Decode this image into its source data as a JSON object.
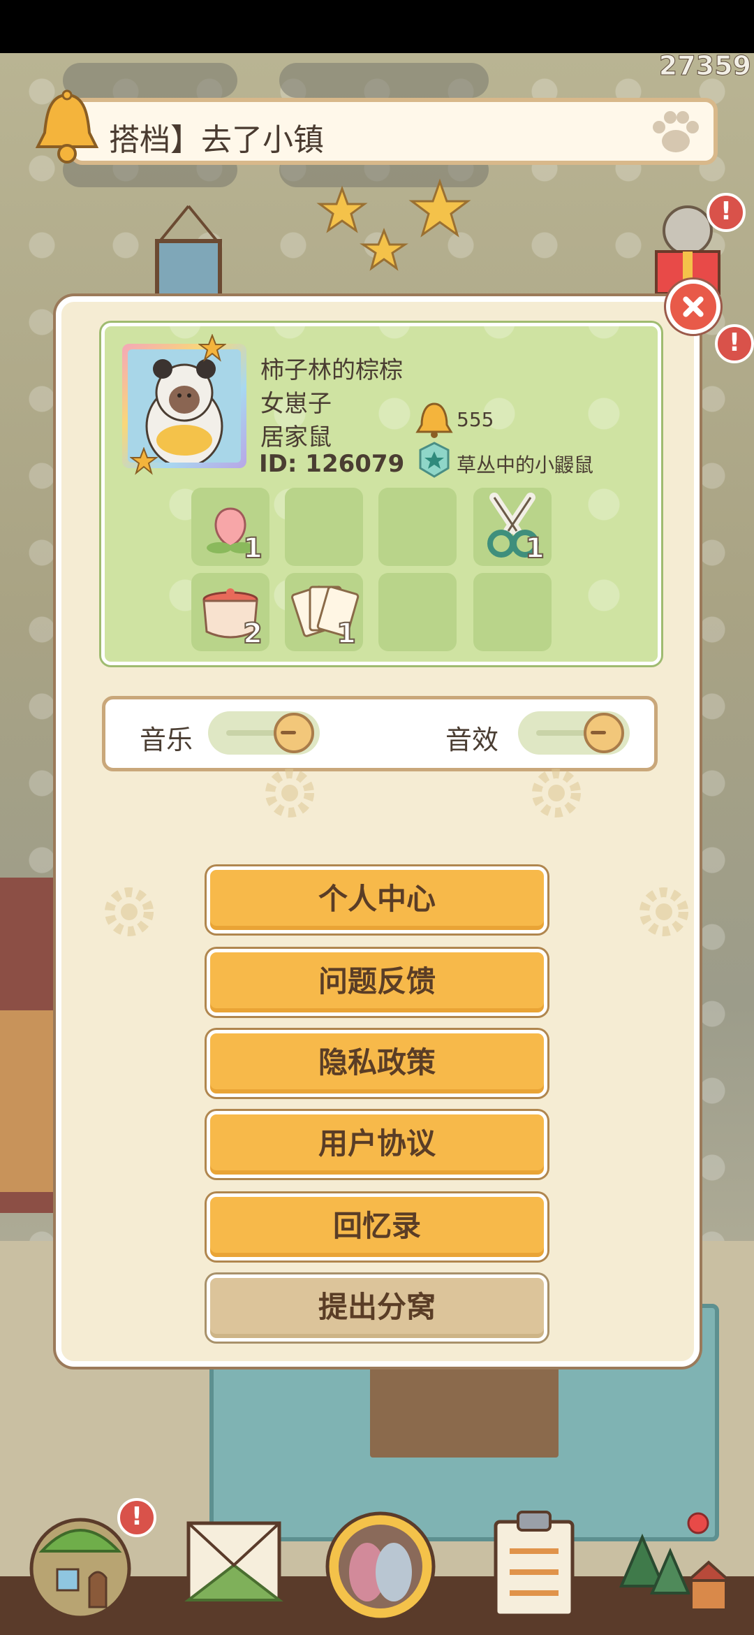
{
  "hud": {
    "score": "27359",
    "ticker_text": "搭档】去了小镇",
    "alert_mark": "!"
  },
  "profile": {
    "name": "柿子林的棕棕",
    "gender": "女崽子",
    "title": "居家鼠",
    "id": "ID: 126079",
    "bells": "555",
    "badge": "草丛中的小鼹鼠"
  },
  "items": [
    {
      "name": "peach",
      "count": "1"
    },
    {
      "name": "empty",
      "count": ""
    },
    {
      "name": "empty",
      "count": ""
    },
    {
      "name": "scissors",
      "count": "1"
    },
    {
      "name": "pot",
      "count": "2"
    },
    {
      "name": "cards",
      "count": "1"
    },
    {
      "name": "empty",
      "count": ""
    },
    {
      "name": "empty",
      "count": ""
    }
  ],
  "settings": {
    "music_label": "音乐",
    "sfx_label": "音效"
  },
  "menu": {
    "personal_center": "个人中心",
    "feedback": "问题反馈",
    "privacy": "隐私政策",
    "agreement": "用户协议",
    "memories": "回忆录",
    "leave_nest": "提出分窝"
  },
  "colors": {
    "menu_button": "#f7b94a",
    "leave_button": "#dcc49a",
    "card": "#cfe3a2",
    "close": "#e85a49"
  }
}
